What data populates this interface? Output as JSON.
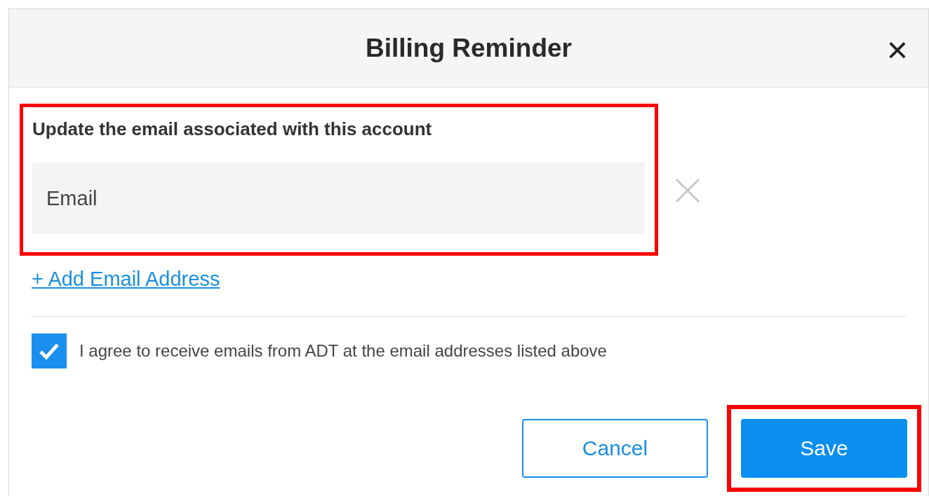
{
  "dialog": {
    "title": "Billing Reminder",
    "close": "×"
  },
  "email_section": {
    "highlighted": true,
    "label": "Update the email associated with this account",
    "email_field": {
      "placeholder": "Email"
    },
    "add_link": "+ Add Email Address"
  },
  "consent": {
    "checked": true,
    "label": "I agree to receive emails from ADT at the email addresses listed above"
  },
  "buttons": [
    {
      "kind": "secondary",
      "label": "Cancel",
      "highlighted": false
    },
    {
      "kind": "primary",
      "label": "Save",
      "highlighted": true
    }
  ]
}
